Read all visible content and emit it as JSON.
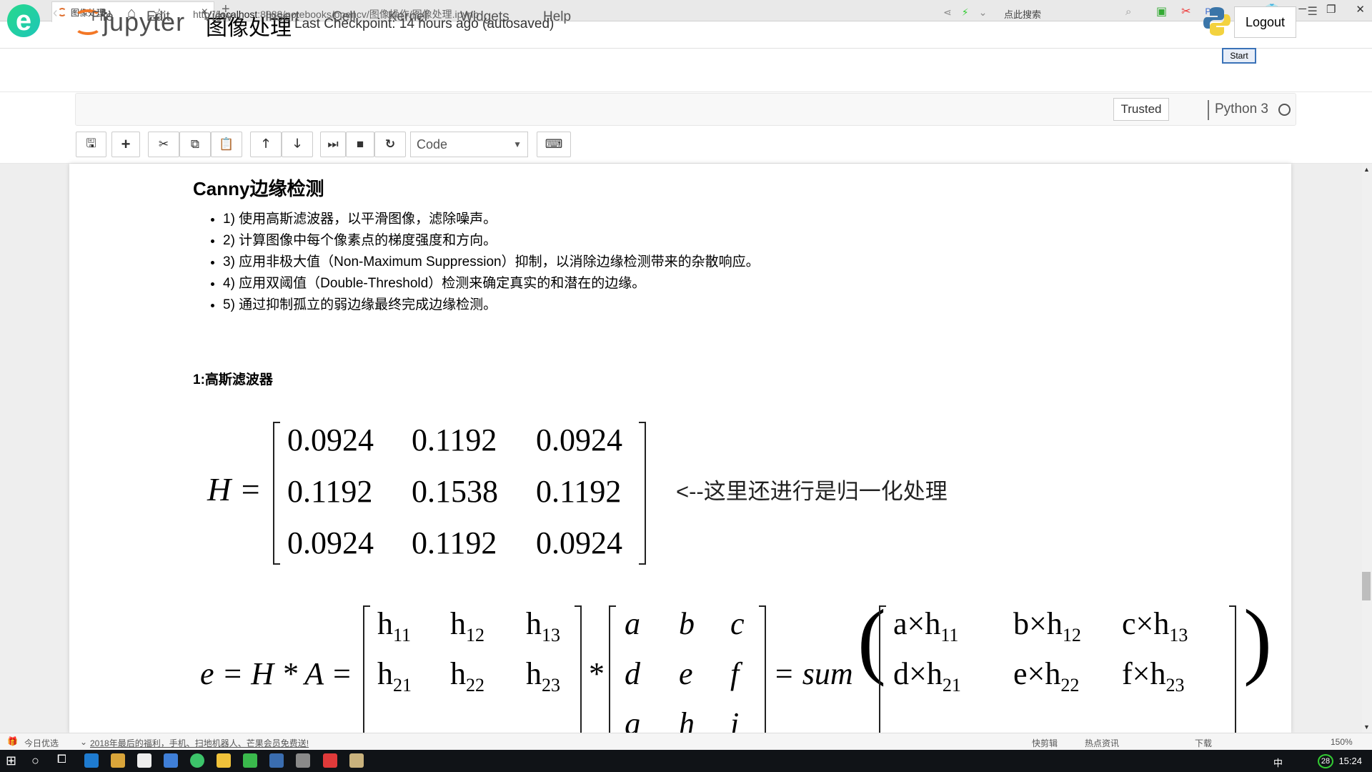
{
  "browser": {
    "tab_title": "图像处理",
    "url_prefix": "http://",
    "url_host": "localhost",
    "url_rest": ":8888/notebooks/opencv/图像操作/图像处理.ipynb",
    "search_placeholder": "点此搜索",
    "popup_button": "Start",
    "ext_label": "Poi...",
    "zoom_level": "150%"
  },
  "header": {
    "logo_text": "jupyter",
    "notebook_name": "图像处理",
    "checkpoint": "Last Checkpoint: 14 hours ago (autosaved)",
    "logout_label": "Logout"
  },
  "menubar": {
    "items": [
      "File",
      "Edit",
      "View",
      "Insert",
      "Cell",
      "Kernel",
      "Widgets",
      "Help"
    ],
    "trusted_label": "Trusted",
    "kernel_name": "Python 3"
  },
  "toolbar": {
    "cell_type": "Code"
  },
  "content": {
    "title": "Canny边缘检测",
    "steps": [
      "1) 使用高斯滤波器，以平滑图像，滤除噪声。",
      "2) 计算图像中每个像素点的梯度强度和方向。",
      "3) 应用非极大值（Non-Maximum Suppression）抑制，以消除边缘检测带来的杂散响应。",
      "4) 应用双阈值（Double-Threshold）检测来确定真实的和潜在的边缘。",
      "5) 通过抑制孤立的弱边缘最终完成边缘检测。"
    ],
    "section_title": "1:高斯滤波器",
    "matrix_label": "H =",
    "matrix_H": [
      [
        "0.0924",
        "0.1192",
        "0.0924"
      ],
      [
        "0.1192",
        "0.1538",
        "0.1192"
      ],
      [
        "0.0924",
        "0.1192",
        "0.0924"
      ]
    ],
    "matrix_note": "<--这里还进行是归一化处理",
    "eq2_lhs": "e = H * A =",
    "eq2_sum": "= sum",
    "matrix_h": [
      [
        "h",
        "11"
      ],
      [
        "h",
        "12"
      ],
      [
        "h",
        "13"
      ],
      [
        "h",
        "21"
      ],
      [
        "h",
        "22"
      ],
      [
        "h",
        "23"
      ]
    ],
    "matrix_A": [
      [
        "a",
        "b",
        "c"
      ],
      [
        "d",
        "e",
        "f"
      ],
      [
        "g",
        "h",
        "i"
      ]
    ],
    "matrix_prod": [
      [
        "a×h",
        "11"
      ],
      [
        "b×h",
        "12"
      ],
      [
        "c×h",
        "13"
      ],
      [
        "d×h",
        "21"
      ],
      [
        "e×h",
        "22"
      ],
      [
        "f×h",
        "23"
      ]
    ]
  },
  "statusbar": {
    "left_label": "今日优选",
    "ad_text": "2018年最后的福利，手机、扫地机器人、芒果会员免费送!",
    "items": [
      "快剪辑",
      "热点资讯",
      "下载"
    ]
  },
  "taskbar": {
    "time": "15:24",
    "ime": "中",
    "badge": "28"
  }
}
